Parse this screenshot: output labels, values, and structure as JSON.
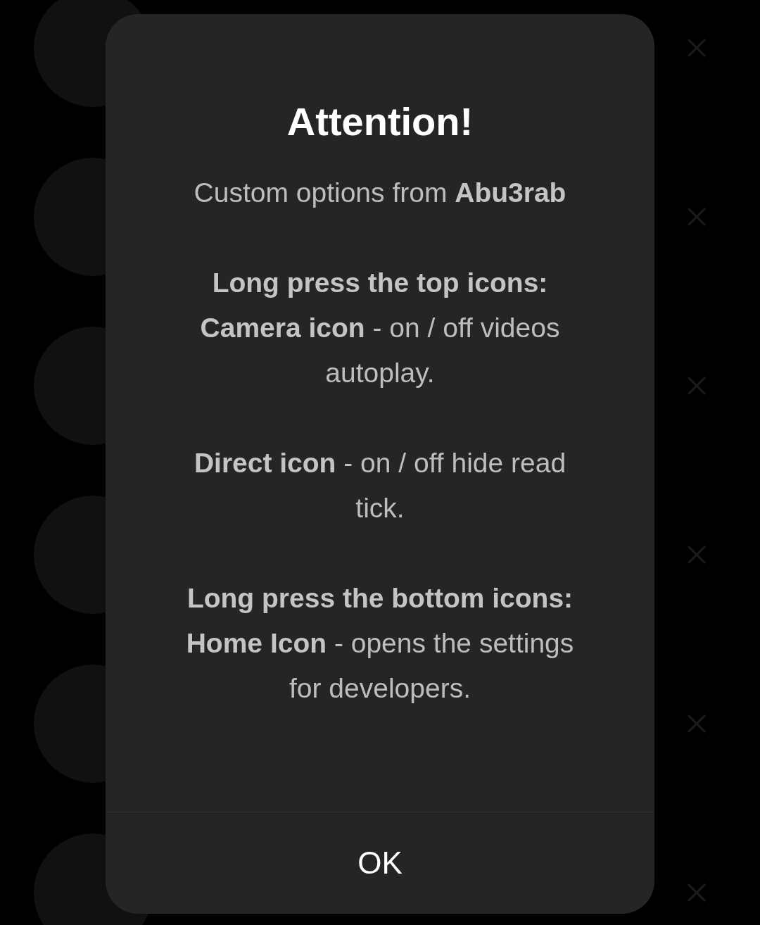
{
  "background": {
    "rows": [
      {},
      {},
      {},
      {},
      {},
      {}
    ]
  },
  "dialog": {
    "title": "Attention!",
    "sections": [
      {
        "lines": [
          {
            "kind": "text",
            "text": "Custom options from **Abu3rab**"
          }
        ]
      },
      {
        "lines": [
          {
            "kind": "heading",
            "text": "Long press the top icons:"
          },
          {
            "kind": "text",
            "text": "**Camera icon** - on / off videos autoplay."
          }
        ]
      },
      {
        "lines": [
          {
            "kind": "text",
            "text": "**Direct icon** - on / off hide read tick."
          }
        ]
      },
      {
        "lines": [
          {
            "kind": "heading",
            "text": "Long press the bottom icons:"
          },
          {
            "kind": "text",
            "text": "**Home Icon** - opens the settings for developers."
          }
        ]
      }
    ],
    "button": "OK"
  }
}
